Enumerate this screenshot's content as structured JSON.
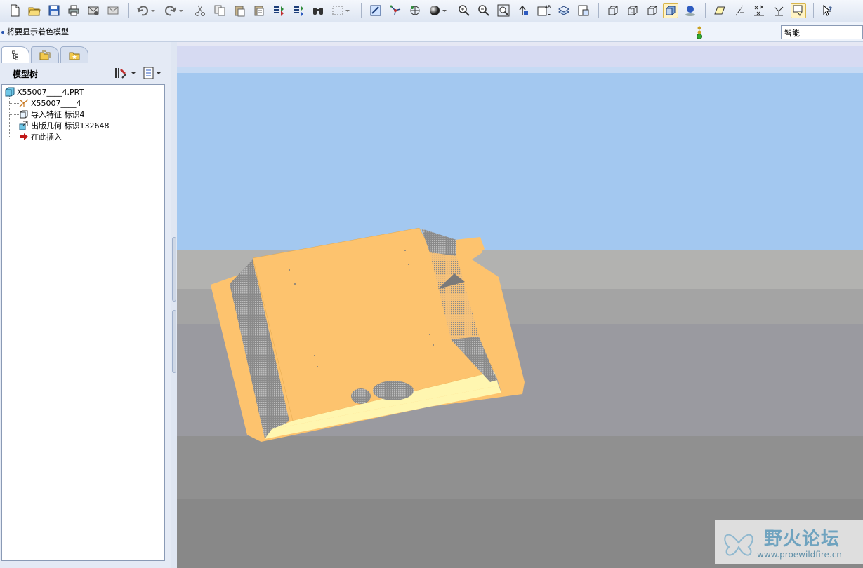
{
  "toolbar": {
    "buttons": [
      {
        "name": "new-file",
        "icon": "new-file-icon"
      },
      {
        "name": "open-file",
        "icon": "open-folder-icon"
      },
      {
        "name": "save",
        "icon": "save-icon"
      },
      {
        "name": "print",
        "icon": "print-icon"
      },
      {
        "name": "send-mail",
        "icon": "mail-icon"
      },
      {
        "name": "send-mail-attach",
        "icon": "mail-attach-icon"
      },
      {
        "name": "undo",
        "icon": "undo-icon"
      },
      {
        "name": "redo",
        "icon": "redo-icon"
      },
      {
        "name": "cut",
        "icon": "cut-icon"
      },
      {
        "name": "copy",
        "icon": "copy-icon"
      },
      {
        "name": "paste",
        "icon": "paste-icon"
      },
      {
        "name": "paste-special",
        "icon": "paste-special-icon"
      },
      {
        "name": "regenerate",
        "icon": "regenerate-icon"
      },
      {
        "name": "regen-manager",
        "icon": "regen-manager-icon"
      },
      {
        "name": "find",
        "icon": "binoculars-icon"
      },
      {
        "name": "select-box",
        "icon": "select-box-icon"
      }
    ],
    "view_buttons": [
      {
        "name": "redraw",
        "icon": "redraw-icon"
      },
      {
        "name": "spin-center",
        "icon": "spin-center-icon"
      },
      {
        "name": "orient-mode",
        "icon": "orient-mode-icon"
      },
      {
        "name": "appearance",
        "icon": "sphere-icon"
      },
      {
        "name": "zoom-in",
        "icon": "zoom-in-icon"
      },
      {
        "name": "zoom-out",
        "icon": "zoom-out-icon"
      },
      {
        "name": "refit",
        "icon": "refit-icon"
      },
      {
        "name": "reorient",
        "icon": "reorient-icon"
      },
      {
        "name": "saved-views",
        "icon": "saved-views-icon"
      },
      {
        "name": "layers",
        "icon": "layers-icon"
      },
      {
        "name": "view-manager",
        "icon": "view-manager-icon"
      }
    ],
    "display_buttons": [
      {
        "name": "wireframe",
        "icon": "wireframe-icon"
      },
      {
        "name": "hidden-line",
        "icon": "hidden-line-icon"
      },
      {
        "name": "no-hidden",
        "icon": "no-hidden-icon"
      },
      {
        "name": "shading",
        "icon": "shading-icon",
        "active": true
      },
      {
        "name": "enhanced-realism",
        "icon": "realism-icon"
      }
    ],
    "datum_buttons": [
      {
        "name": "datum-planes",
        "icon": "datum-plane-icon"
      },
      {
        "name": "datum-axes",
        "icon": "datum-axis-icon"
      },
      {
        "name": "datum-points",
        "icon": "datum-point-icon"
      },
      {
        "name": "coordinate-systems",
        "icon": "csys-icon"
      },
      {
        "name": "annotation",
        "icon": "annotation-icon",
        "active": true
      }
    ],
    "help_button": {
      "name": "context-help",
      "icon": "help-arrow-icon"
    }
  },
  "message": {
    "text": "将要显示着色模型"
  },
  "filter": {
    "value": "智能"
  },
  "left_panel": {
    "tabs": [
      {
        "name": "model-tree-tab",
        "icon": "model-tree-icon",
        "active": true
      },
      {
        "name": "folder-browser-tab",
        "icon": "folder-browser-icon"
      },
      {
        "name": "favorites-tab",
        "icon": "favorites-icon"
      }
    ],
    "title": "模型树",
    "tree": [
      {
        "label": "X55007____4.PRT",
        "icon": "part-icon",
        "level": 0
      },
      {
        "label": "X55007____4",
        "icon": "csys-tree-icon",
        "level": 1
      },
      {
        "label": "导入特征 标识4",
        "icon": "import-feature-icon",
        "level": 1
      },
      {
        "label": "出版几何 标识132648",
        "icon": "publish-geom-icon",
        "level": 1
      },
      {
        "label": "在此插入",
        "icon": "insert-here-icon",
        "level": 1
      }
    ]
  },
  "colors": {
    "sky": "#a3c8f0",
    "floor": "#9a9aa0",
    "part": "#fdc36e",
    "part_light": "#fff6b0",
    "part_wall": "#7a7a7a"
  },
  "watermark": {
    "title": "野火论坛",
    "url": "www.proewildfire.cn"
  }
}
